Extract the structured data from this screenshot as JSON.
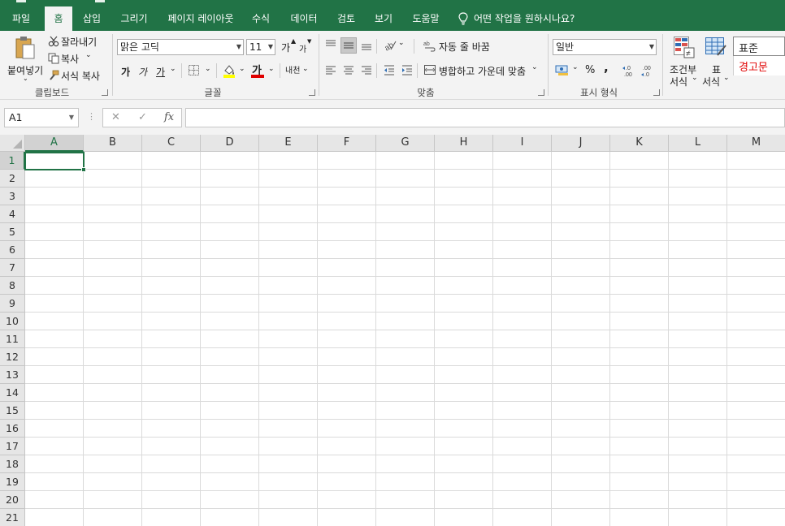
{
  "tabs": [
    "파일",
    "홈",
    "삽입",
    "그리기",
    "페이지 레이아웃",
    "수식",
    "데이터",
    "검토",
    "보기",
    "도움말"
  ],
  "tell_me": "어떤 작업을 원하시나요?",
  "clipboard": {
    "paste": "붙여넣기",
    "cut": "잘라내기",
    "copy": "복사",
    "format_painter": "서식 복사",
    "label": "클립보드"
  },
  "font": {
    "name": "맑은 고딕",
    "size": "11",
    "grow": "가",
    "shrink": "가",
    "bold": "가",
    "italic": "가",
    "underline": "가",
    "font_color": "가",
    "phonetic": "내천",
    "label": "글꼴"
  },
  "alignment": {
    "wrap_text": "자동 줄 바꿈",
    "merge_center": "병합하고 가운데 맞춤",
    "label": "맞춤"
  },
  "number": {
    "format": "일반",
    "percent": "%",
    "comma": ",",
    "label": "표시 형식"
  },
  "styles": {
    "conditional_top": "조건부",
    "conditional_bottom": "서식",
    "table_top": "표",
    "table_bottom": "서식",
    "style_normal": "표준",
    "style_warning": "경고문"
  },
  "formula_bar": {
    "name_box": "A1",
    "cancel": "✕",
    "enter": "✓",
    "fx": "fx",
    "value": ""
  },
  "grid": {
    "columns": [
      "A",
      "B",
      "C",
      "D",
      "E",
      "F",
      "G",
      "H",
      "I",
      "J",
      "K",
      "L",
      "M"
    ],
    "rows": [
      "1",
      "2",
      "3",
      "4",
      "5",
      "6",
      "7",
      "8",
      "9",
      "10",
      "11",
      "12",
      "13",
      "14",
      "15",
      "16",
      "17",
      "18",
      "19",
      "20",
      "21"
    ],
    "active_cell": "A1"
  },
  "colors": {
    "accent": "#217346",
    "highlight_yellow": "#ffff00",
    "font_red": "#e00000",
    "warning_text": "#e00000"
  }
}
